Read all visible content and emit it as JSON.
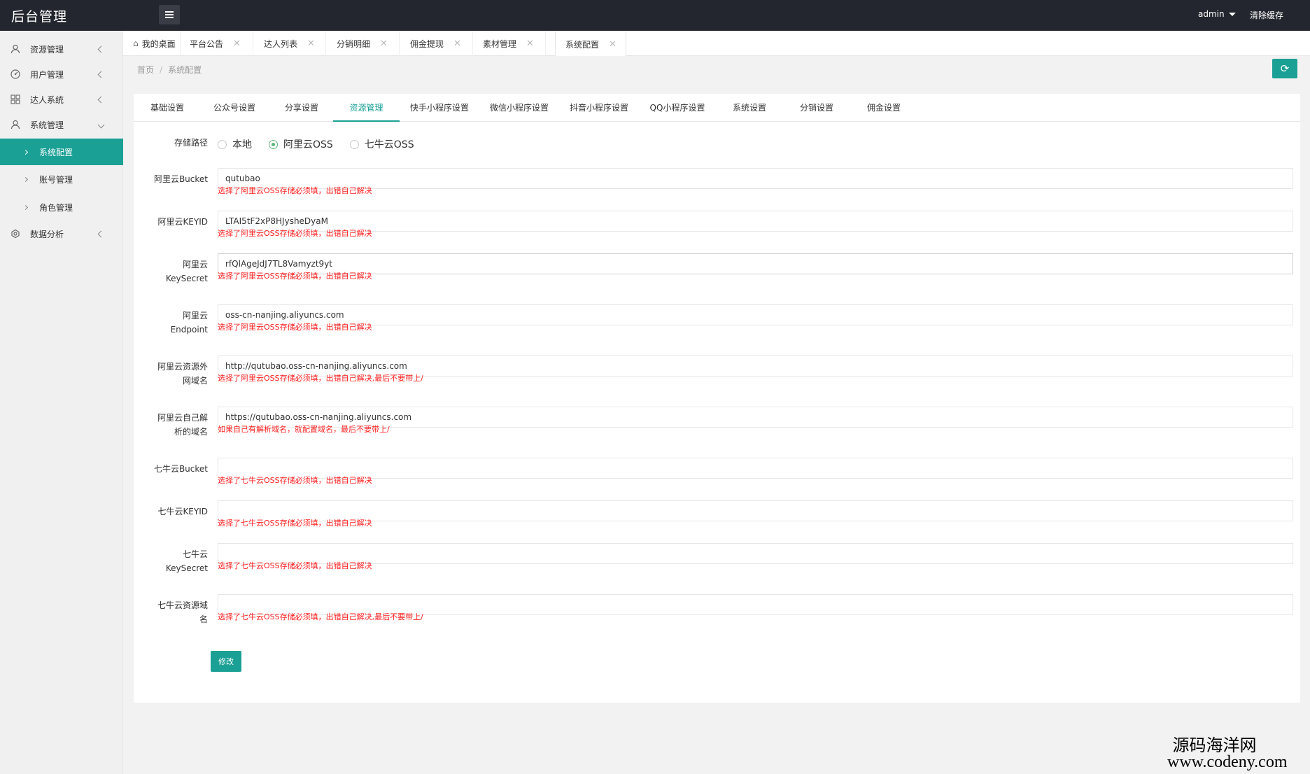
{
  "header": {
    "title": "后台管理",
    "user": "admin",
    "clear_cache": "清除缓存"
  },
  "sidebar": {
    "items": [
      {
        "label": "资源管理",
        "icon": "user-icon"
      },
      {
        "label": "用户管理",
        "icon": "dashboard-icon"
      },
      {
        "label": "达人系统",
        "icon": "grid-icon"
      },
      {
        "label": "系统管理",
        "icon": "user-icon"
      },
      {
        "label": "数据分析",
        "icon": "gear-icon"
      }
    ],
    "sub_items": [
      {
        "label": "系统配置",
        "active": true
      },
      {
        "label": "账号管理",
        "active": false
      },
      {
        "label": "角色管理",
        "active": false
      }
    ]
  },
  "tabs": [
    {
      "label": "我的桌面"
    },
    {
      "label": "平台公告"
    },
    {
      "label": "达人列表"
    },
    {
      "label": "分销明细"
    },
    {
      "label": "佣金提现"
    },
    {
      "label": "素材管理"
    },
    {
      "label": "系统配置"
    }
  ],
  "breadcrumb": {
    "home": "首页",
    "sep": "/",
    "current": "系统配置"
  },
  "subtabs": [
    {
      "label": "基础设置"
    },
    {
      "label": "公众号设置"
    },
    {
      "label": "分享设置"
    },
    {
      "label": "资源管理"
    },
    {
      "label": "快手小程序设置"
    },
    {
      "label": "微信小程序设置"
    },
    {
      "label": "抖音小程序设置"
    },
    {
      "label": "QQ小程序设置"
    },
    {
      "label": "系统设置"
    },
    {
      "label": "分销设置"
    },
    {
      "label": "佣金设置"
    }
  ],
  "form": {
    "storage_label": "存储路径",
    "storage_options": [
      "本地",
      "阿里云OSS",
      "七牛云OSS"
    ],
    "storage_selected": "阿里云OSS",
    "fields": [
      {
        "label1": "阿里云Bucket",
        "label2": "",
        "value": "qutubao",
        "tip": "选择了阿里云OSS存储必须填，出错自己解决"
      },
      {
        "label1": "阿里云KEYID",
        "label2": "",
        "value": "LTAI5tF2xP8HJysheDyaM",
        "tip": "选择了阿里云OSS存储必须填，出错自己解决"
      },
      {
        "label1": "阿里云",
        "label2": "KeySecret",
        "value": "rfQlAgeJdJ7TL8Vamyzt9yt",
        "tip": "选择了阿里云OSS存储必须填，出错自己解决"
      },
      {
        "label1": "阿里云",
        "label2": "Endpoint",
        "value": "oss-cn-nanjing.aliyuncs.com",
        "tip": "选择了阿里云OSS存储必须填，出错自己解决"
      },
      {
        "label1": "阿里云资源外",
        "label2": "网域名",
        "value": "http://qutubao.oss-cn-nanjing.aliyuncs.com",
        "tip": "选择了阿里云OSS存储必须填，出错自己解决,最后不要带上/"
      },
      {
        "label1": "阿里云自己解",
        "label2": "析的域名",
        "value": "https://qutubao.oss-cn-nanjing.aliyuncs.com",
        "tip": "如果自己有解析域名，就配置域名，最后不要带上/"
      },
      {
        "label1": "七牛云Bucket",
        "label2": "",
        "value": "",
        "tip": "选择了七牛云OSS存储必须填，出错自己解决"
      },
      {
        "label1": "七牛云KEYID",
        "label2": "",
        "value": "",
        "tip": "选择了七牛云OSS存储必须填，出错自己解决"
      },
      {
        "label1": "七牛云",
        "label2": "KeySecret",
        "value": "",
        "tip": "选择了七牛云OSS存储必须填，出错自己解决"
      },
      {
        "label1": "七牛云资源域",
        "label2": "名",
        "value": "",
        "tip": "选择了七牛云OSS存储必须填，出错自己解决,最后不要带上/"
      }
    ],
    "submit_label": "修改"
  },
  "watermark": {
    "cn": "源码海洋网",
    "en": "www.codeny.com"
  },
  "colors": {
    "accent": "#1aa094",
    "header_bg": "#23262e",
    "tip": "#ff2020",
    "radio_checked": "#5fb878"
  }
}
